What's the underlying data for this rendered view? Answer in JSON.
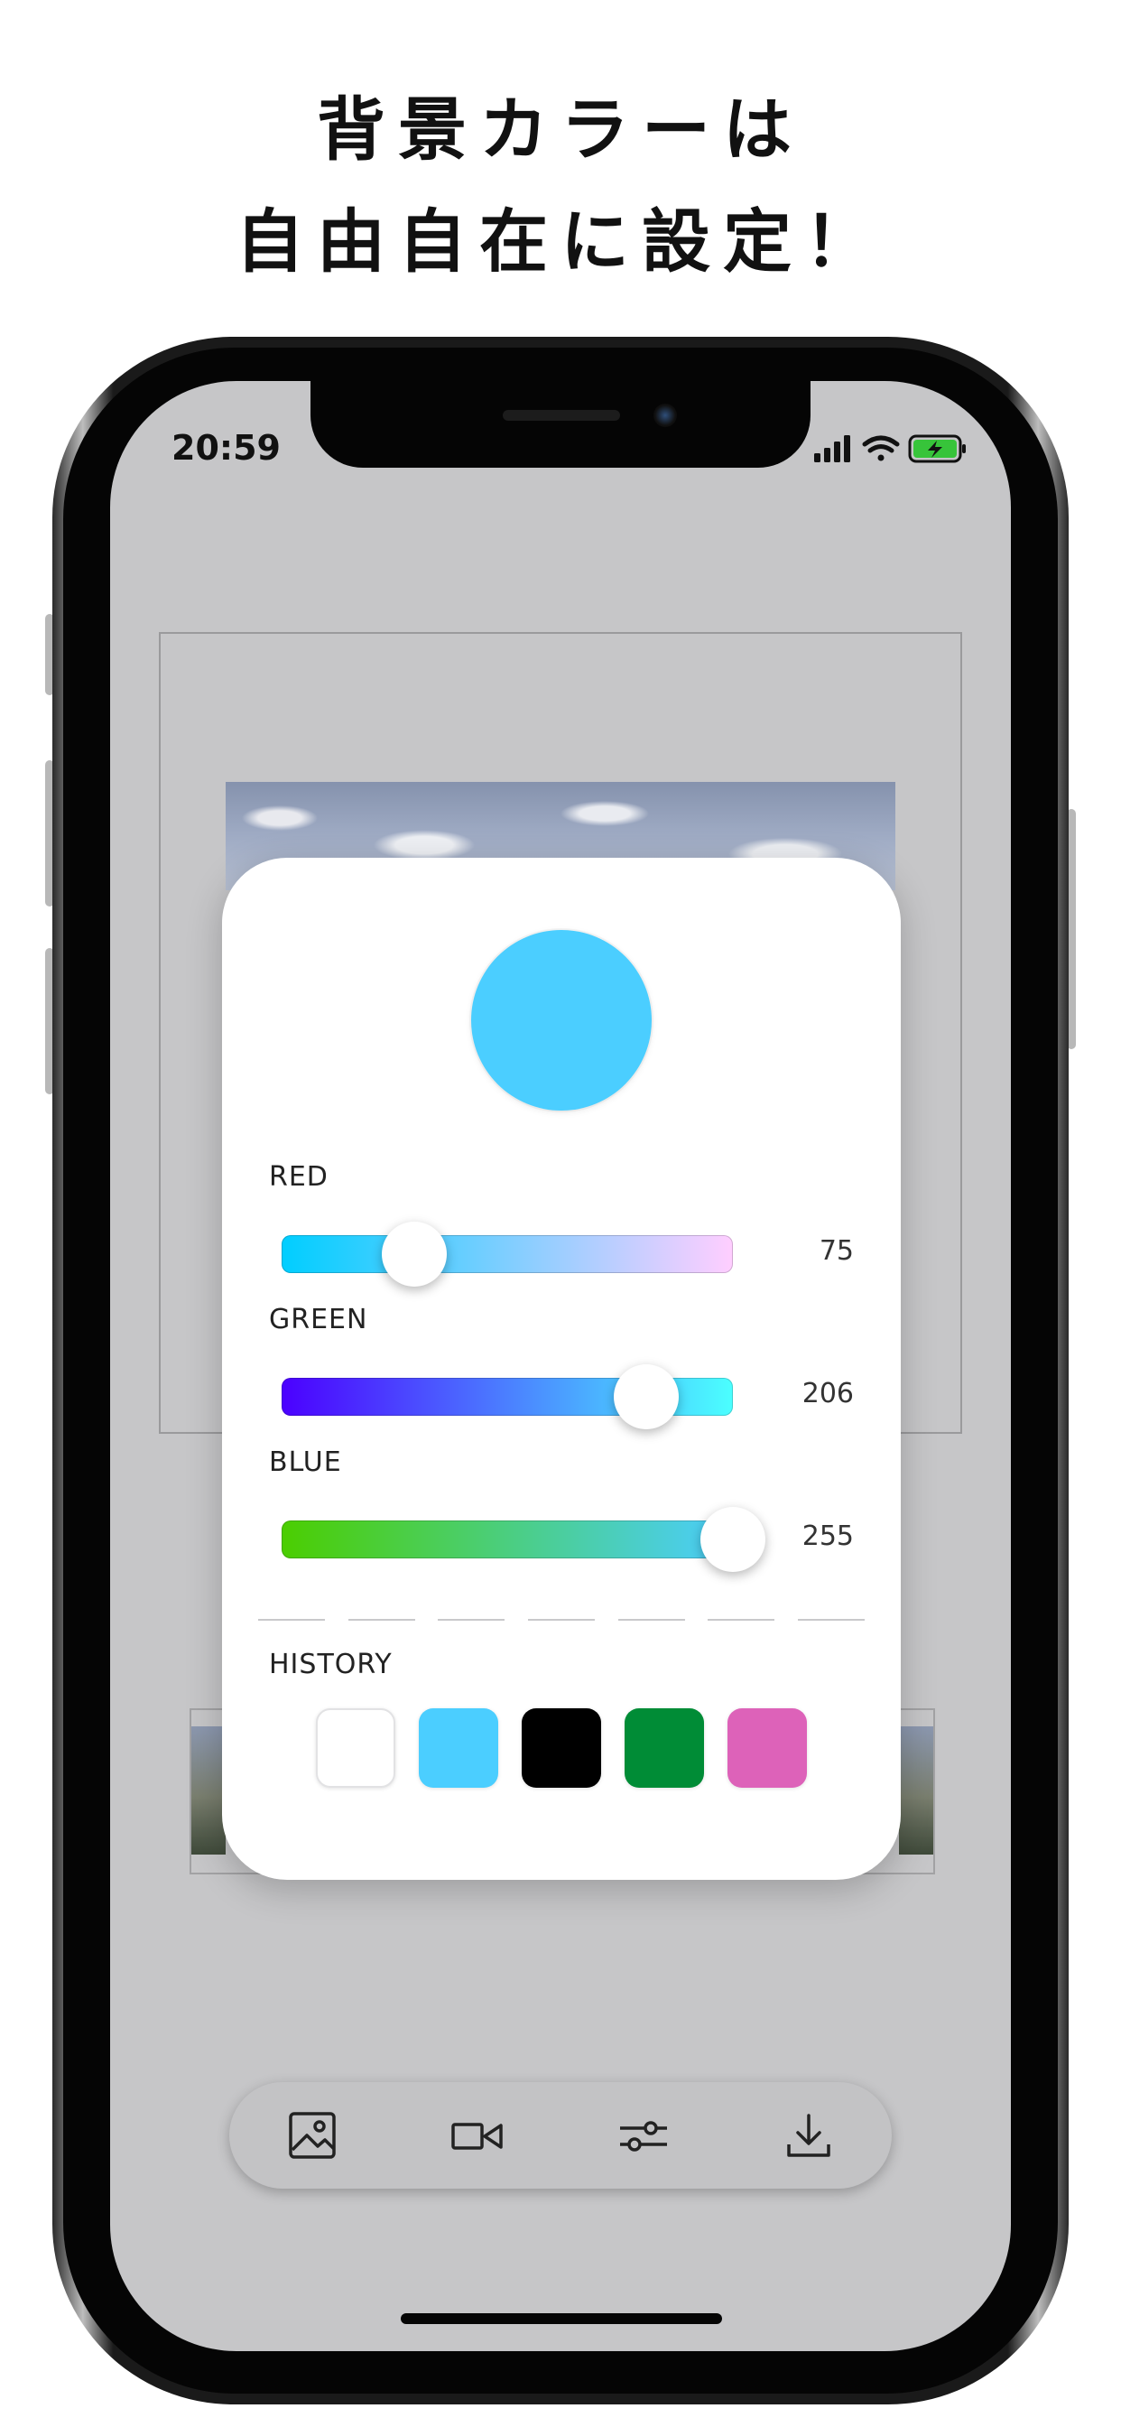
{
  "headline": {
    "line1": "背景カラーは",
    "line2": "自由自在に設定！"
  },
  "status_bar": {
    "time": "20:59",
    "icons": [
      "signal-icon",
      "wifi-icon",
      "battery-charging-icon"
    ]
  },
  "color_picker": {
    "preview_color": "#4BCEFF",
    "sliders": [
      {
        "label": "RED",
        "value": "75",
        "level": 0.294,
        "gradient": [
          "#00CEFF",
          "#FFCEFF"
        ]
      },
      {
        "label": "GREEN",
        "value": "206",
        "level": 0.808,
        "gradient": [
          "#4B00FF",
          "#4BFFFF"
        ]
      },
      {
        "label": "BLUE",
        "value": "255",
        "level": 1.0,
        "gradient": [
          "#4BCE00",
          "#4BCEFF"
        ]
      }
    ],
    "history_label": "HISTORY",
    "history": [
      "#FFFFFF",
      "#4BCEFF",
      "#000000",
      "#008C36",
      "#DD62B9"
    ]
  },
  "toolbar": {
    "items": [
      "image-icon",
      "video-icon",
      "sliders-icon",
      "download-icon"
    ]
  }
}
